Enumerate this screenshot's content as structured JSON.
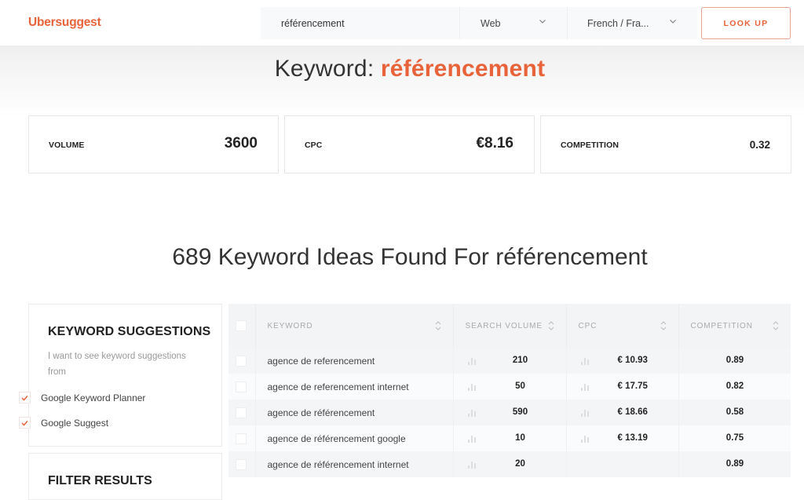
{
  "header": {
    "logo": "Ubersuggest",
    "search_value": "référencement",
    "search_placeholder": "",
    "source_select": "Web",
    "language_select": "French / Fra...",
    "lookup_label": "LOOK UP"
  },
  "title": {
    "prefix": "Keyword: ",
    "keyword": "référencement"
  },
  "metrics": {
    "volume_label": "VOLUME",
    "volume_value": "3600",
    "cpc_label": "CPC",
    "cpc_value": "€8.16",
    "competition_label": "COMPETITION",
    "competition_value": "0.32"
  },
  "ideas_heading": "689 Keyword Ideas Found For référencement",
  "sidebar": {
    "suggestions_title": "KEYWORD SUGGESTIONS",
    "suggestions_desc": "I want to see keyword suggestions from",
    "options": [
      {
        "label": "Google Keyword Planner",
        "checked": true
      },
      {
        "label": "Google Suggest",
        "checked": true
      }
    ],
    "filter_title": "FILTER RESULTS"
  },
  "table": {
    "columns": [
      "KEYWORD",
      "SEARCH VOLUME",
      "CPC",
      "COMPETITION"
    ],
    "rows": [
      {
        "keyword": "agence de referencement",
        "volume": "210",
        "cpc": "€ 10.93",
        "competition": "0.89"
      },
      {
        "keyword": "agence de referencement internet",
        "volume": "50",
        "cpc": "€ 17.75",
        "competition": "0.82"
      },
      {
        "keyword": "agence de référencement",
        "volume": "590",
        "cpc": "€ 18.66",
        "competition": "0.58"
      },
      {
        "keyword": "agence de référencement google",
        "volume": "10",
        "cpc": "€ 13.19",
        "competition": "0.75"
      },
      {
        "keyword": "agence de référencement internet",
        "volume": "20",
        "cpc": "",
        "competition": "0.89"
      }
    ]
  },
  "colors": {
    "brand": "#e8623a"
  },
  "icons": {
    "select_chevron": "chevron-down-icon",
    "sort": "sort-icon",
    "trend": "bar-chart-icon",
    "check": "check-icon"
  }
}
